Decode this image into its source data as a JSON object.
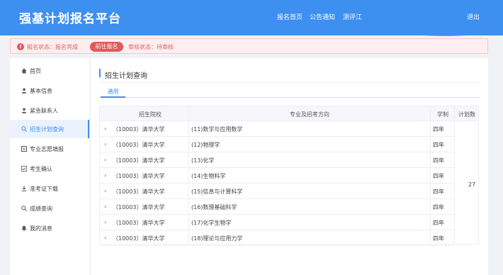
{
  "header": {
    "title": "强基计划报名平台",
    "nav": [
      "报名首页",
      "公告通知",
      "测评江"
    ],
    "logout": "退出"
  },
  "status": {
    "icon": "warning-icon",
    "reg_status": "报名状态：报名完成",
    "goto_button": "前往报名",
    "review_status": "审核状态：待审核"
  },
  "sidebar": {
    "items": [
      {
        "label": "首页",
        "icon": "home-icon"
      },
      {
        "label": "基本信息",
        "icon": "user-icon"
      },
      {
        "label": "紧急联系人",
        "icon": "contact-icon"
      },
      {
        "label": "招生计划查询",
        "icon": "search-icon",
        "active": true
      },
      {
        "label": "专业志愿填报",
        "icon": "form-icon"
      },
      {
        "label": "考生确认",
        "icon": "check-icon"
      },
      {
        "label": "准考证下载",
        "icon": "download-icon"
      },
      {
        "label": "成绩查询",
        "icon": "search-icon"
      },
      {
        "label": "我的消息",
        "icon": "bell-icon"
      }
    ]
  },
  "main": {
    "title": "招生计划查询",
    "tab": "通用",
    "columns": [
      "招生院校",
      "专业及招考方向",
      "学制",
      "计划数"
    ],
    "rows": [
      {
        "school": "（10003）清华大学",
        "major": "(11)数学与应用数学",
        "years": "四年"
      },
      {
        "school": "（10003）清华大学",
        "major": "(12)物理学",
        "years": "四年"
      },
      {
        "school": "（10003）清华大学",
        "major": "(13)化学",
        "years": "四年"
      },
      {
        "school": "（10003）清华大学",
        "major": "(14)生物科学",
        "years": "四年"
      },
      {
        "school": "（10003）清华大学",
        "major": "(15)信息与计算科学",
        "years": "四年"
      },
      {
        "school": "（10003）清华大学",
        "major": "(16)数理基础科学",
        "years": "四年"
      },
      {
        "school": "（10003）清华大学",
        "major": "(17)化学生物学",
        "years": "四年"
      },
      {
        "school": "（10003）清华大学",
        "major": "(18)理论与应用力学",
        "years": "四年"
      }
    ],
    "plan_count": "27"
  },
  "colors": {
    "primary": "#3d8ff0",
    "danger": "#e05a5a"
  }
}
